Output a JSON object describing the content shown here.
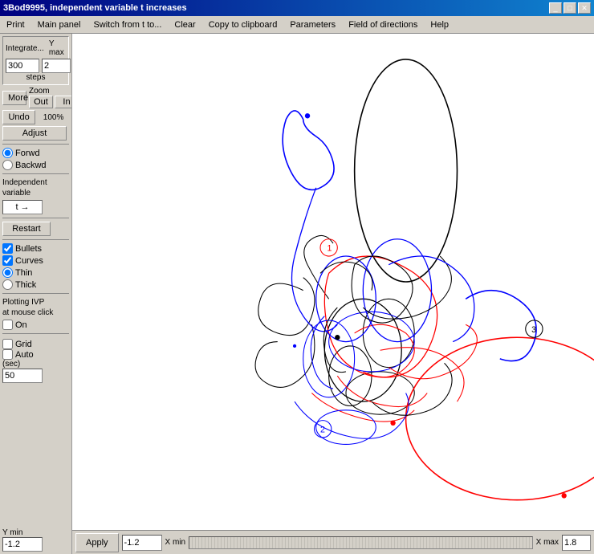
{
  "titleBar": {
    "title": "3Bod9995, independent variable t   increases",
    "buttons": [
      "_",
      "□",
      "✕"
    ]
  },
  "menuBar": {
    "items": [
      "Print",
      "Main panel",
      "Switch from t  to...",
      "Clear",
      "Copy to clipboard",
      "Parameters",
      "Field of directions",
      "Help"
    ]
  },
  "leftPanel": {
    "integrateLabel": "Integrate...",
    "yMaxLabel": "Y max",
    "stepsValue": "300",
    "yMaxValue": "2",
    "stepsLabel": "steps",
    "moreLabel": "More",
    "undoLabel": "Undo",
    "zoomLabel": "Zoom",
    "outLabel": "Out",
    "inLabel": "In",
    "zoomPercent": "100%",
    "adjustLabel": "Adjust",
    "forwardLabel": "Forwd",
    "backwardLabel": "Backwd",
    "indepVarLabel": "Independent\nvariable",
    "indepVarValue": "t →",
    "restartLabel": "Restart",
    "bulletsLabel": "Bullets",
    "curvesLabel": "Curves",
    "thinLabel": "Thin",
    "thickLabel": "Thick",
    "plottingIVPLabel": "Plotting IVP\nat mouse click",
    "onLabel": "On",
    "gridLabel": "Grid",
    "autoLabel": "Auto",
    "secLabel": "(sec)",
    "secValue": "50",
    "yMinLabel": "Y min",
    "yMinValue": "-1.2"
  },
  "bottomBar": {
    "applyLabel": "Apply",
    "xMinValue": "-1.2",
    "xMinLabel": "X min",
    "xMaxLabel": "X max",
    "xMaxValue": "1.8"
  },
  "plot": {
    "curves": []
  }
}
